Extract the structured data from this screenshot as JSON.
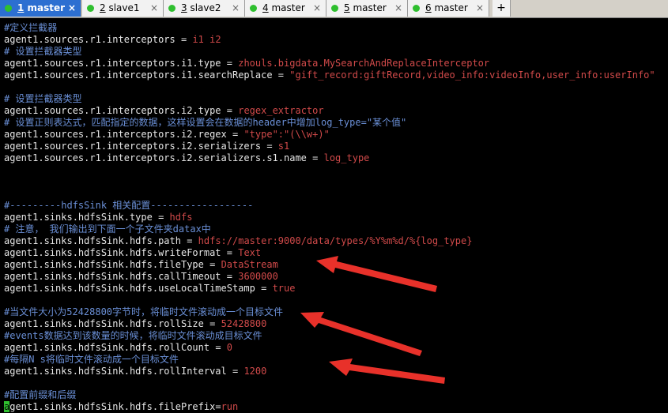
{
  "tabs": [
    {
      "num": "1",
      "name": "master",
      "active": true
    },
    {
      "num": "2",
      "name": "slave1",
      "active": false
    },
    {
      "num": "3",
      "name": "slave2",
      "active": false
    },
    {
      "num": "4",
      "name": "master",
      "active": false
    },
    {
      "num": "5",
      "name": "master",
      "active": false
    },
    {
      "num": "6",
      "name": "master",
      "active": false
    }
  ],
  "new_tab_label": "+",
  "close_glyph": "×",
  "lines": [
    {
      "type": "comment",
      "text": "#定义拦截器"
    },
    {
      "type": "kv",
      "key": "agent1.sources.r1.interceptors",
      "value": "i1 i2"
    },
    {
      "type": "comment",
      "text": "# 设置拦截器类型"
    },
    {
      "type": "kv",
      "key": "agent1.sources.r1.interceptors.i1.type",
      "value": "zhouls.bigdata.MySearchAndReplaceInterceptor"
    },
    {
      "type": "kv",
      "key": "agent1.sources.r1.interceptors.i1.searchReplace",
      "value": "\"gift_record:giftRecord,video_info:videoInfo,user_info:userInfo\""
    },
    {
      "type": "blank"
    },
    {
      "type": "comment",
      "text": "# 设置拦截器类型"
    },
    {
      "type": "kv",
      "key": "agent1.sources.r1.interceptors.i2.type",
      "value": "regex_extractor"
    },
    {
      "type": "comment",
      "text": "# 设置正则表达式，匹配指定的数据，这样设置会在数据的header中增加log_type=\"某个值\""
    },
    {
      "type": "kv",
      "key": "agent1.sources.r1.interceptors.i2.regex",
      "value": "\"type\":\"(\\\\w+)\""
    },
    {
      "type": "kv",
      "key": "agent1.sources.r1.interceptors.i2.serializers",
      "value": "s1"
    },
    {
      "type": "kv",
      "key": "agent1.sources.r1.interceptors.i2.serializers.s1.name",
      "value": "log_type"
    },
    {
      "type": "blank"
    },
    {
      "type": "blank"
    },
    {
      "type": "blank"
    },
    {
      "type": "comment",
      "text": "#---------hdfsSink 相关配置------------------"
    },
    {
      "type": "kv",
      "key": "agent1.sinks.hdfsSink.type",
      "value": "hdfs"
    },
    {
      "type": "comment",
      "text": "# 注意， 我们输出到下面一个子文件夹datax中"
    },
    {
      "type": "kv",
      "key": "agent1.sinks.hdfsSink.hdfs.path",
      "value": "hdfs://master:9000/data/types/%Y%m%d/%{log_type}"
    },
    {
      "type": "kv",
      "key": "agent1.sinks.hdfsSink.hdfs.writeFormat",
      "value": "Text"
    },
    {
      "type": "kv",
      "key": "agent1.sinks.hdfsSink.hdfs.fileType",
      "value": "DataStream"
    },
    {
      "type": "kv",
      "key": "agent1.sinks.hdfsSink.hdfs.callTimeout",
      "value": "3600000"
    },
    {
      "type": "kv",
      "key": "agent1.sinks.hdfsSink.hdfs.useLocalTimeStamp",
      "value": "true"
    },
    {
      "type": "blank"
    },
    {
      "type": "comment",
      "text": "#当文件大小为52428800字节时，将临时文件滚动成一个目标文件"
    },
    {
      "type": "kv",
      "key": "agent1.sinks.hdfsSink.hdfs.rollSize",
      "value": "52428800"
    },
    {
      "type": "comment",
      "text": "#events数据达到该数量的时候，将临时文件滚动成目标文件"
    },
    {
      "type": "kv",
      "key": "agent1.sinks.hdfsSink.hdfs.rollCount",
      "value": "0"
    },
    {
      "type": "comment",
      "text": "#每隔N s将临时文件滚动成一个目标文件"
    },
    {
      "type": "kv",
      "key": "agent1.sinks.hdfsSink.hdfs.rollInterval",
      "value": "1200"
    },
    {
      "type": "blank"
    },
    {
      "type": "comment",
      "text": "#配置前缀和后缀"
    },
    {
      "type": "cursor_kv",
      "cursor_char": "a",
      "key": "gent1.sinks.hdfsSink.hdfs.filePrefix",
      "sep": "=",
      "value": "run"
    }
  ],
  "colors": {
    "comment": "#6a8fd6",
    "value": "#d14a4a",
    "text": "#e6e6e6",
    "cursor": "#2fbf2f",
    "arrow": "#e8312a",
    "tab_active": "#2c6fd1",
    "status_dot": "#2fbf2f"
  }
}
